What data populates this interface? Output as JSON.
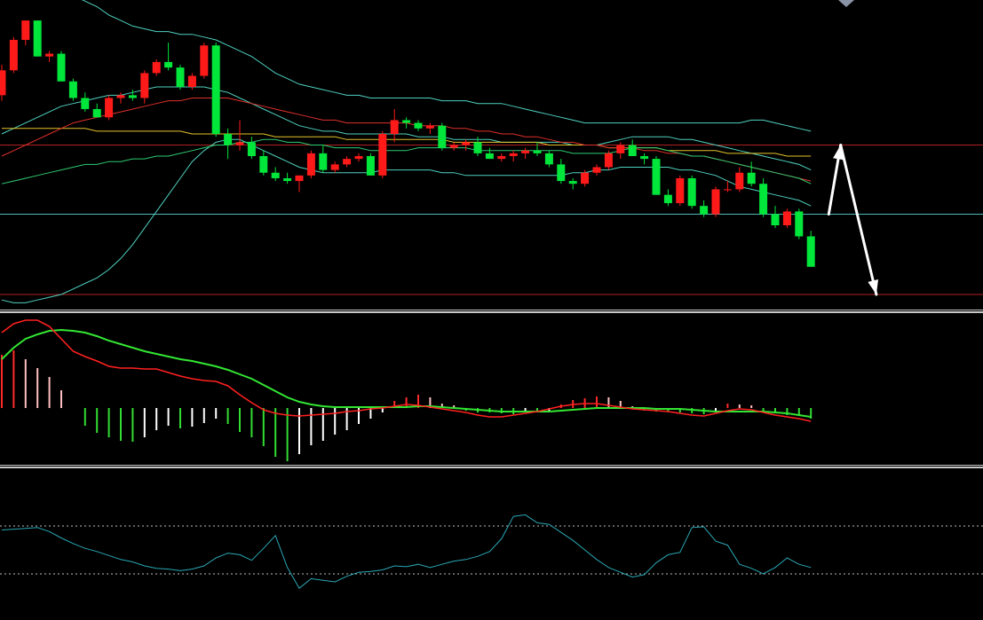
{
  "colors": {
    "background": "#000000",
    "up_candle": "#ff1a1a",
    "down_candle": "#00e63a",
    "bollinger": "#4fd1c0",
    "ma_short": "#2ecc71",
    "ma_mid": "#e0302a",
    "ma_long": "#e6c229",
    "reference_line_red": "#b02020",
    "reference_line_teal": "#4fb8b8",
    "macd_line": "#ff2020",
    "signal_line": "#33e633",
    "hist_pos_strong": "#ff2a2a",
    "hist_pos_weak": "#ffc0c0",
    "hist_neg_strong": "#33dd33",
    "hist_neg_weak": "#ffffff",
    "oscillator": "#2aa7b5",
    "dashed_level": "#bbbbbb",
    "arrow": "#ffffff"
  },
  "chart_data": [
    {
      "type": "candlestick",
      "panel": "price",
      "y_range": [
        0,
        100
      ],
      "ohlc": [
        [
          72,
          83,
          70,
          81
        ],
        [
          81,
          93,
          80,
          92
        ],
        [
          92,
          99,
          90,
          99
        ],
        [
          99,
          99,
          86,
          86
        ],
        [
          86,
          88,
          84,
          87
        ],
        [
          87,
          88,
          77,
          77
        ],
        [
          77,
          78,
          70,
          71
        ],
        [
          71,
          73,
          66,
          67
        ],
        [
          67,
          69,
          64,
          64
        ],
        [
          64,
          72,
          63,
          71
        ],
        [
          71,
          73,
          69,
          72
        ],
        [
          72,
          74,
          70,
          71
        ],
        [
          71,
          81,
          69,
          80
        ],
        [
          80,
          85,
          79,
          84
        ],
        [
          84,
          91,
          81,
          82
        ],
        [
          82,
          83,
          74,
          75
        ],
        [
          75,
          80,
          74,
          79
        ],
        [
          79,
          91,
          78,
          90
        ],
        [
          90,
          91,
          57,
          58
        ],
        [
          58,
          60,
          49,
          54
        ],
        [
          54,
          63,
          52,
          55
        ],
        [
          55,
          57,
          49,
          50
        ],
        [
          50,
          52,
          43,
          44
        ],
        [
          44,
          46,
          41,
          42
        ],
        [
          42,
          44,
          40,
          41
        ],
        [
          41,
          43,
          37,
          43
        ],
        [
          43,
          52,
          42,
          51
        ],
        [
          51,
          54,
          44,
          45
        ],
        [
          45,
          48,
          44,
          47
        ],
        [
          47,
          50,
          46,
          49
        ],
        [
          49,
          51,
          48,
          50
        ],
        [
          50,
          51,
          43,
          43
        ],
        [
          43,
          59,
          42,
          58
        ],
        [
          58,
          67,
          55,
          63
        ],
        [
          63,
          64,
          60,
          62
        ],
        [
          62,
          63,
          59,
          60
        ],
        [
          60,
          62,
          58,
          61
        ],
        [
          61,
          62,
          52,
          53
        ],
        [
          53,
          55,
          52,
          54
        ],
        [
          54,
          56,
          52,
          55
        ],
        [
          55,
          57,
          50,
          51
        ],
        [
          51,
          53,
          49,
          49
        ],
        [
          49,
          51,
          48,
          50
        ],
        [
          50,
          52,
          48,
          51
        ],
        [
          51,
          53,
          49,
          52
        ],
        [
          52,
          55,
          50,
          51
        ],
        [
          51,
          52,
          46,
          47
        ],
        [
          47,
          49,
          40,
          41
        ],
        [
          41,
          42,
          38,
          40
        ],
        [
          40,
          45,
          39,
          44
        ],
        [
          44,
          47,
          43,
          46
        ],
        [
          46,
          52,
          45,
          51
        ],
        [
          51,
          55,
          49,
          54
        ],
        [
          54,
          56,
          50,
          50
        ],
        [
          50,
          51,
          47,
          49
        ],
        [
          49,
          50,
          36,
          36
        ],
        [
          36,
          38,
          32,
          33
        ],
        [
          33,
          43,
          32,
          42
        ],
        [
          42,
          43,
          31,
          32
        ],
        [
          32,
          34,
          28,
          29
        ],
        [
          29,
          39,
          28,
          38
        ],
        [
          38,
          41,
          37,
          38
        ],
        [
          38,
          46,
          37,
          44
        ],
        [
          44,
          48,
          39,
          40
        ],
        [
          40,
          42,
          28,
          29
        ],
        [
          29,
          32,
          24,
          25
        ],
        [
          25,
          31,
          24,
          30
        ],
        [
          30,
          31,
          20,
          21
        ],
        [
          21,
          23,
          10,
          10
        ]
      ],
      "sma_short": [
        40,
        41,
        42,
        43,
        44,
        45,
        46,
        47,
        47,
        48,
        48,
        49,
        49,
        50,
        50,
        51,
        52,
        53,
        54,
        54,
        55,
        55,
        56,
        56,
        55,
        55,
        54,
        54,
        53,
        53,
        53,
        52,
        52,
        52,
        52,
        53,
        53,
        53,
        53,
        53,
        52,
        52,
        52,
        52,
        52,
        52,
        52,
        52,
        51,
        51,
        51,
        51,
        52,
        53,
        53,
        53,
        52,
        51,
        50,
        50,
        49,
        48,
        47,
        46,
        45,
        44,
        43,
        42,
        40
      ],
      "sma_mid": [
        50,
        52,
        54,
        56,
        58,
        60,
        62,
        63,
        64,
        65,
        66,
        67,
        68,
        69,
        70,
        70,
        71,
        71,
        71,
        71,
        70,
        69,
        68,
        67,
        66,
        65,
        64,
        63,
        63,
        62,
        62,
        62,
        62,
        62,
        62,
        61,
        61,
        61,
        60,
        60,
        59,
        59,
        58,
        58,
        57,
        57,
        56,
        55,
        55,
        54,
        54,
        53,
        53,
        53,
        52,
        52,
        51,
        51,
        50,
        50,
        49,
        48,
        47,
        46,
        45,
        44,
        43,
        42,
        41
      ],
      "sma_long": [
        60,
        60,
        60,
        60,
        60,
        60,
        60,
        60,
        59,
        59,
        59,
        59,
        59,
        59,
        59,
        59,
        58,
        58,
        58,
        58,
        58,
        58,
        58,
        57,
        57,
        57,
        57,
        57,
        57,
        56,
        56,
        56,
        56,
        56,
        56,
        56,
        56,
        56,
        55,
        55,
        55,
        55,
        55,
        55,
        55,
        55,
        54,
        54,
        54,
        54,
        54,
        53,
        53,
        53,
        53,
        53,
        52,
        52,
        52,
        52,
        52,
        51,
        51,
        51,
        51,
        51,
        50,
        50,
        50
      ],
      "boll_upper": [
        110,
        112,
        113,
        113,
        112,
        110,
        108,
        106,
        104,
        101,
        99,
        97,
        96,
        95,
        95,
        94,
        94,
        93,
        92,
        90,
        88,
        86,
        83,
        80,
        78,
        76,
        75,
        74,
        73,
        72,
        72,
        71,
        71,
        71,
        71,
        71,
        71,
        70,
        70,
        70,
        69,
        69,
        69,
        68,
        67,
        66,
        65,
        64,
        63,
        62,
        62,
        62,
        62,
        62,
        62,
        62,
        62,
        62,
        62,
        62,
        62,
        62,
        62,
        63,
        63,
        62,
        61,
        60,
        59
      ],
      "boll_mid": [
        58,
        60,
        62,
        64,
        66,
        68,
        69,
        70,
        71,
        72,
        72,
        73,
        74,
        75,
        75,
        75,
        75,
        75,
        74,
        73,
        71,
        69,
        67,
        65,
        63,
        61,
        60,
        59,
        59,
        58,
        58,
        58,
        58,
        58,
        58,
        57,
        57,
        57,
        56,
        56,
        56,
        56,
        55,
        55,
        55,
        55,
        55,
        55,
        54,
        54,
        54,
        55,
        56,
        57,
        57,
        57,
        57,
        56,
        56,
        55,
        54,
        53,
        52,
        51,
        50,
        49,
        48,
        47,
        45
      ],
      "boll_lower": [
        -2,
        -3,
        -3,
        -2,
        -1,
        0,
        2,
        4,
        6,
        9,
        13,
        18,
        24,
        30,
        36,
        42,
        48,
        52,
        55,
        56,
        56,
        54,
        52,
        50,
        48,
        46,
        45,
        44,
        44,
        44,
        44,
        44,
        45,
        45,
        45,
        45,
        45,
        44,
        44,
        43,
        43,
        43,
        43,
        43,
        43,
        43,
        43,
        43,
        44,
        44,
        45,
        45,
        46,
        46,
        46,
        46,
        46,
        45,
        45,
        44,
        43,
        41,
        39,
        38,
        37,
        36,
        35,
        34,
        32
      ],
      "reference_levels": [
        54,
        29,
        0
      ],
      "projection": "up then down",
      "projection_path": [
        [
          69.5,
          29
        ],
        [
          70.5,
          54
        ],
        [
          73.5,
          0
        ]
      ]
    },
    {
      "type": "macd",
      "panel": "macd",
      "y_range": [
        -60,
        100
      ],
      "macd": [
        85,
        95,
        99,
        99,
        92,
        78,
        64,
        58,
        53,
        47,
        45,
        45,
        44,
        44,
        40,
        36,
        33,
        31,
        30,
        25,
        15,
        6,
        -2,
        -6,
        -8,
        -9,
        -8,
        -7,
        -6,
        -4,
        -3,
        -1,
        0,
        2,
        4,
        3,
        1,
        -1,
        -3,
        -5,
        -8,
        -10,
        -10,
        -8,
        -6,
        -4,
        -1,
        2,
        4,
        5,
        5,
        3,
        1,
        -1,
        -2,
        -3,
        -4,
        -6,
        -8,
        -9,
        -6,
        -3,
        -1,
        -2,
        -5,
        -8,
        -10,
        -12,
        -15
      ],
      "signal": [
        55,
        68,
        78,
        83,
        87,
        88,
        87,
        85,
        81,
        76,
        72,
        68,
        64,
        61,
        58,
        55,
        53,
        50,
        47,
        43,
        38,
        33,
        26,
        19,
        12,
        7,
        4,
        2,
        1,
        1,
        1,
        1,
        1,
        1,
        1,
        2,
        2,
        1,
        0,
        -1,
        -2,
        -3,
        -4,
        -4,
        -4,
        -4,
        -4,
        -3,
        -2,
        -1,
        0,
        0,
        0,
        0,
        0,
        -1,
        -1,
        -1,
        -2,
        -3,
        -4,
        -4,
        -4,
        -4,
        -4,
        -5,
        -6,
        -8,
        -10
      ],
      "histogram": [
        60,
        65,
        55,
        45,
        35,
        20,
        0,
        -20,
        -28,
        -33,
        -37,
        -38,
        -33,
        -25,
        -20,
        -23,
        -21,
        -17,
        -12,
        -18,
        -27,
        -33,
        -43,
        -55,
        -60,
        -52,
        -42,
        -37,
        -30,
        -25,
        -18,
        -12,
        -5,
        8,
        12,
        15,
        12,
        5,
        3,
        -3,
        -5,
        -5,
        -6,
        -7,
        -5,
        -5,
        -3,
        4,
        9,
        11,
        13,
        12,
        8,
        2,
        -3,
        -4,
        -4,
        -5,
        -6,
        -7,
        -3,
        5,
        4,
        3,
        -3,
        -6,
        -8,
        -9,
        -12
      ]
    },
    {
      "type": "line",
      "panel": "oscillator",
      "y_range": [
        0,
        100
      ],
      "levels": [
        80,
        20
      ],
      "values": [
        75,
        76,
        77,
        78,
        73,
        65,
        58,
        52,
        48,
        43,
        38,
        35,
        30,
        27,
        26,
        24,
        26,
        30,
        40,
        46,
        44,
        37,
        52,
        68,
        28,
        2,
        14,
        12,
        10,
        17,
        22,
        23,
        25,
        30,
        29,
        32,
        28,
        32,
        36,
        38,
        42,
        48,
        64,
        92,
        94,
        84,
        82,
        72,
        62,
        50,
        38,
        28,
        22,
        16,
        19,
        34,
        44,
        47,
        78,
        79,
        61,
        56,
        32,
        27,
        20,
        28,
        40,
        32,
        28
      ]
    }
  ]
}
